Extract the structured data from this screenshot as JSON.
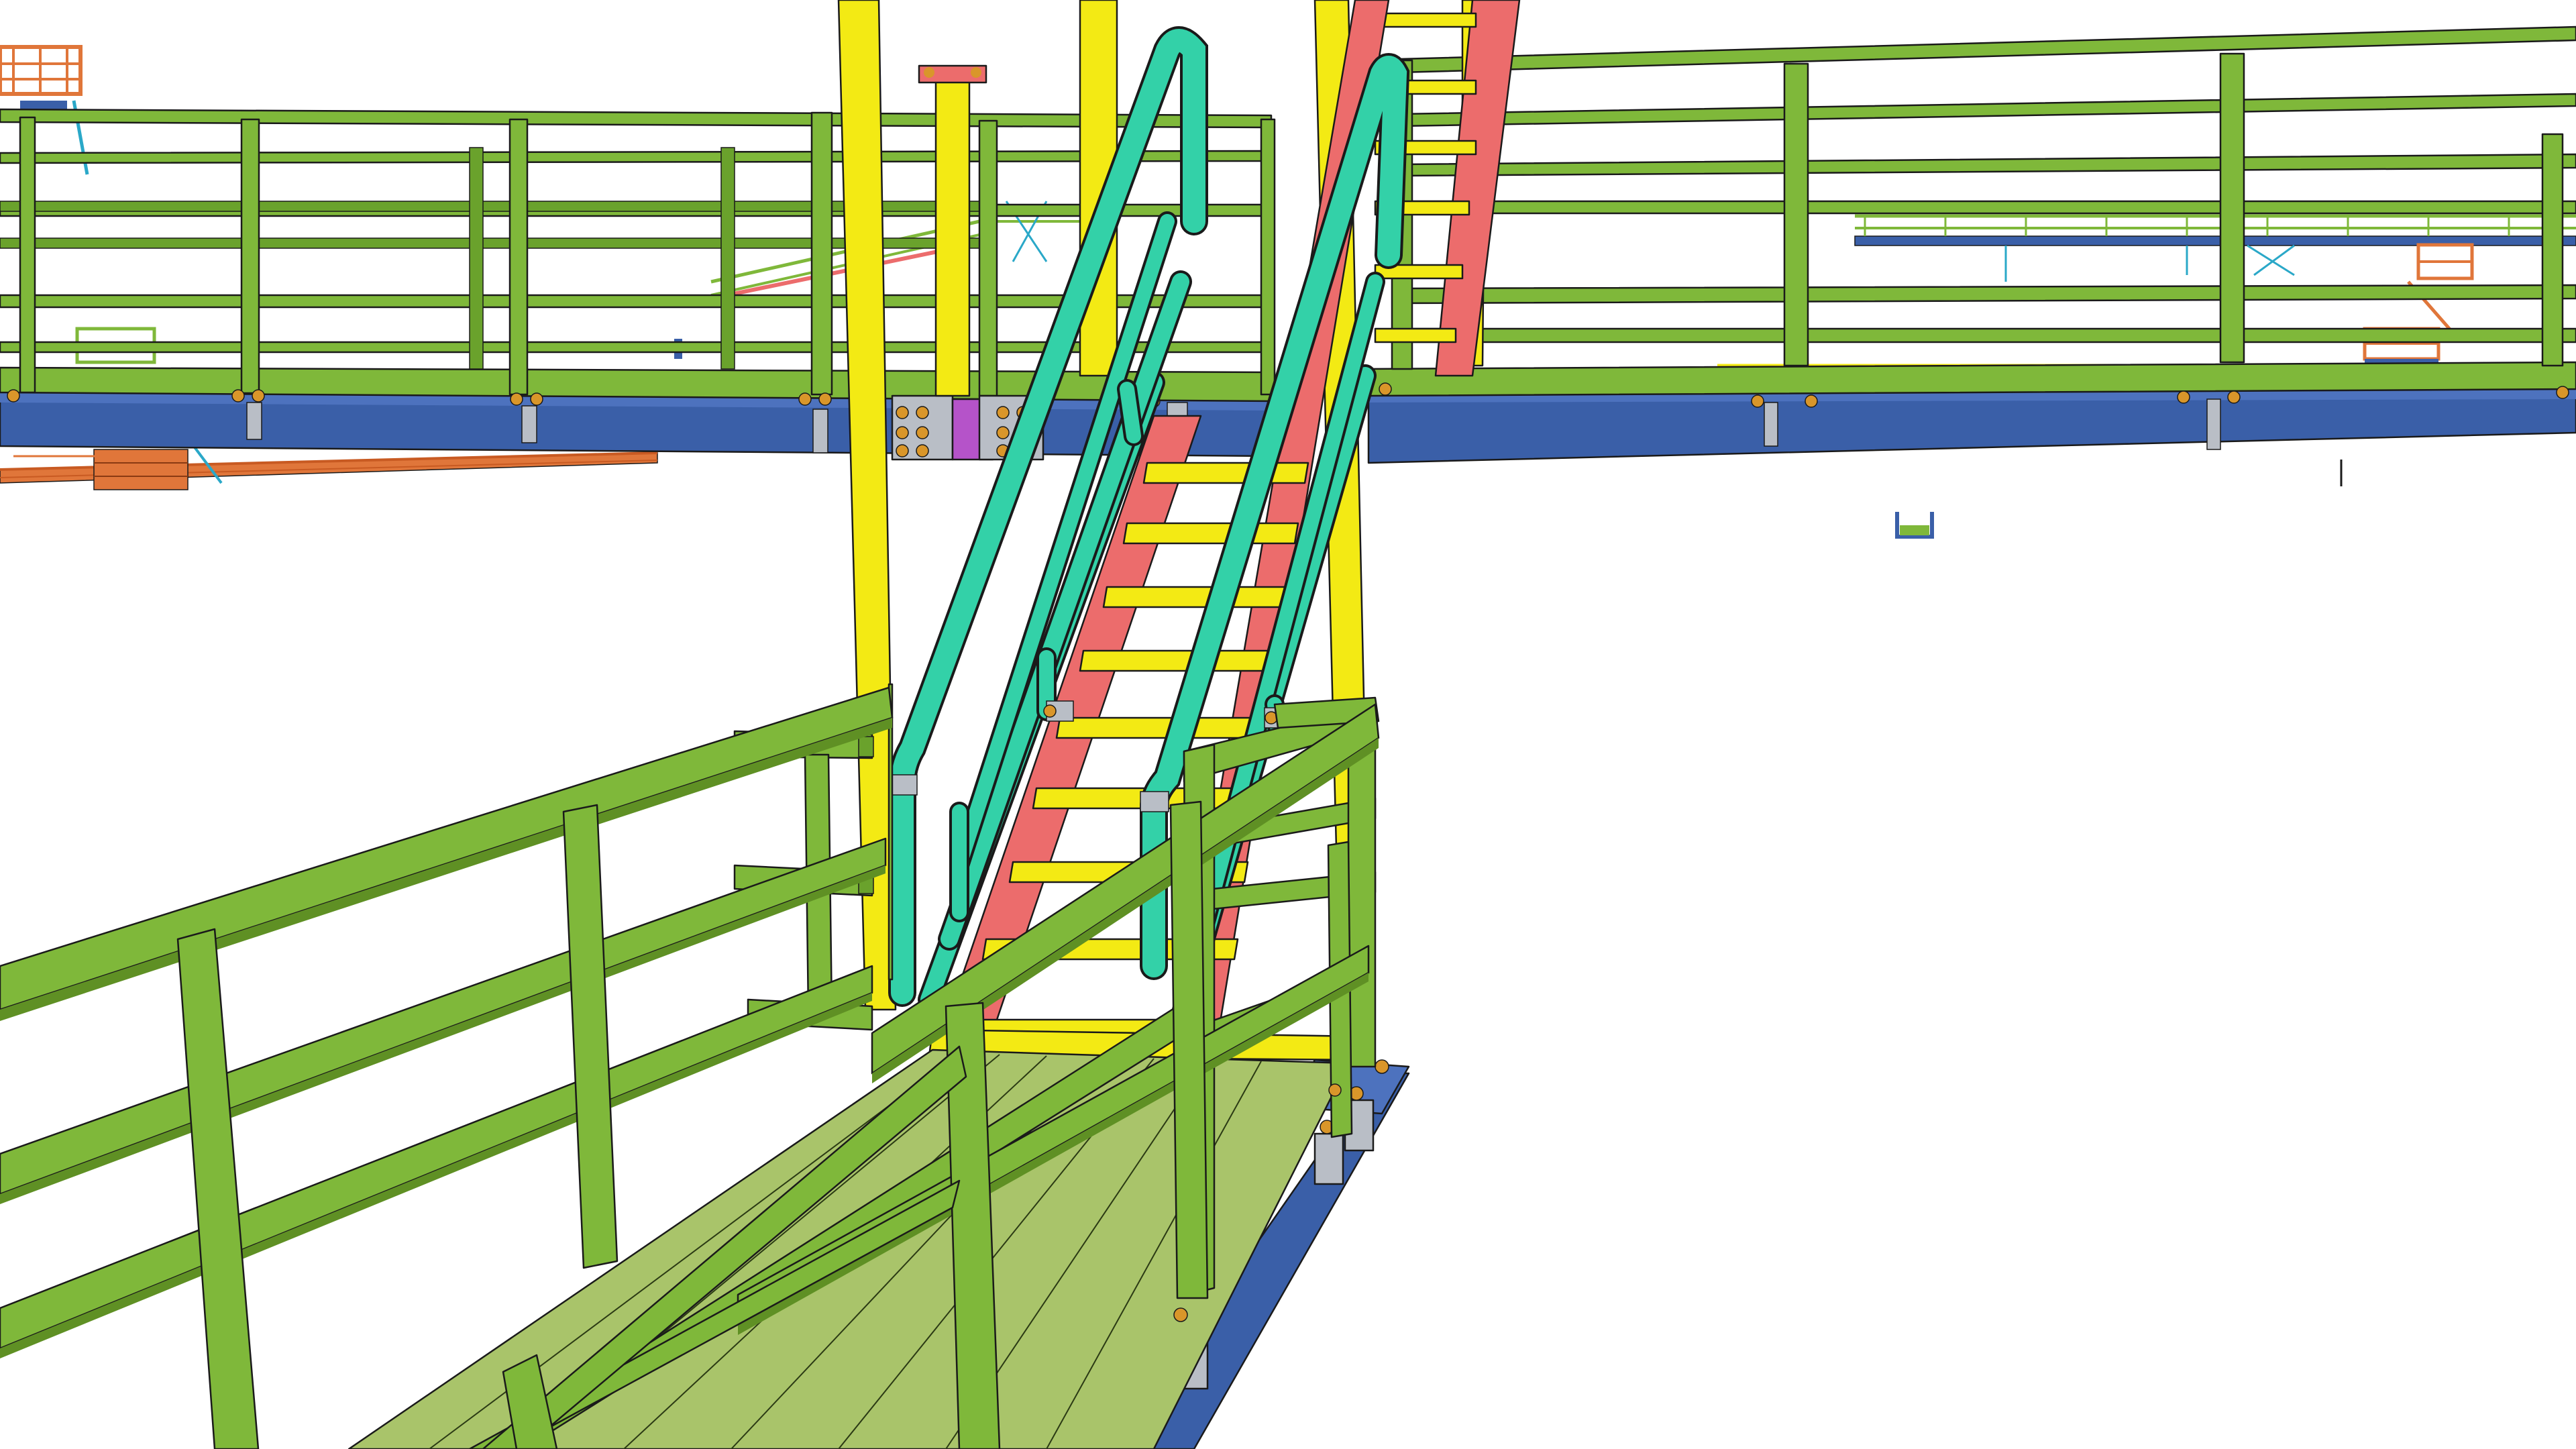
{
  "colors": {
    "background": "#ffffff",
    "handrail": "#7fb83a",
    "handrail_dark": "#5f9024",
    "beam": "#3a5fa8",
    "beam_dark": "#2b4785",
    "column": "#f3ea14",
    "stair_stringer": "#ec6c6c",
    "stair_tread": "#f3ea14",
    "stair_rail": "#33d1a8",
    "grating": "#a9c46a",
    "bolt": "#d9962a",
    "plate": "#b9bec6",
    "purple_plate": "#b553c9",
    "distant_orange": "#e0763a",
    "distant_cyan": "#2aa8c8"
  }
}
